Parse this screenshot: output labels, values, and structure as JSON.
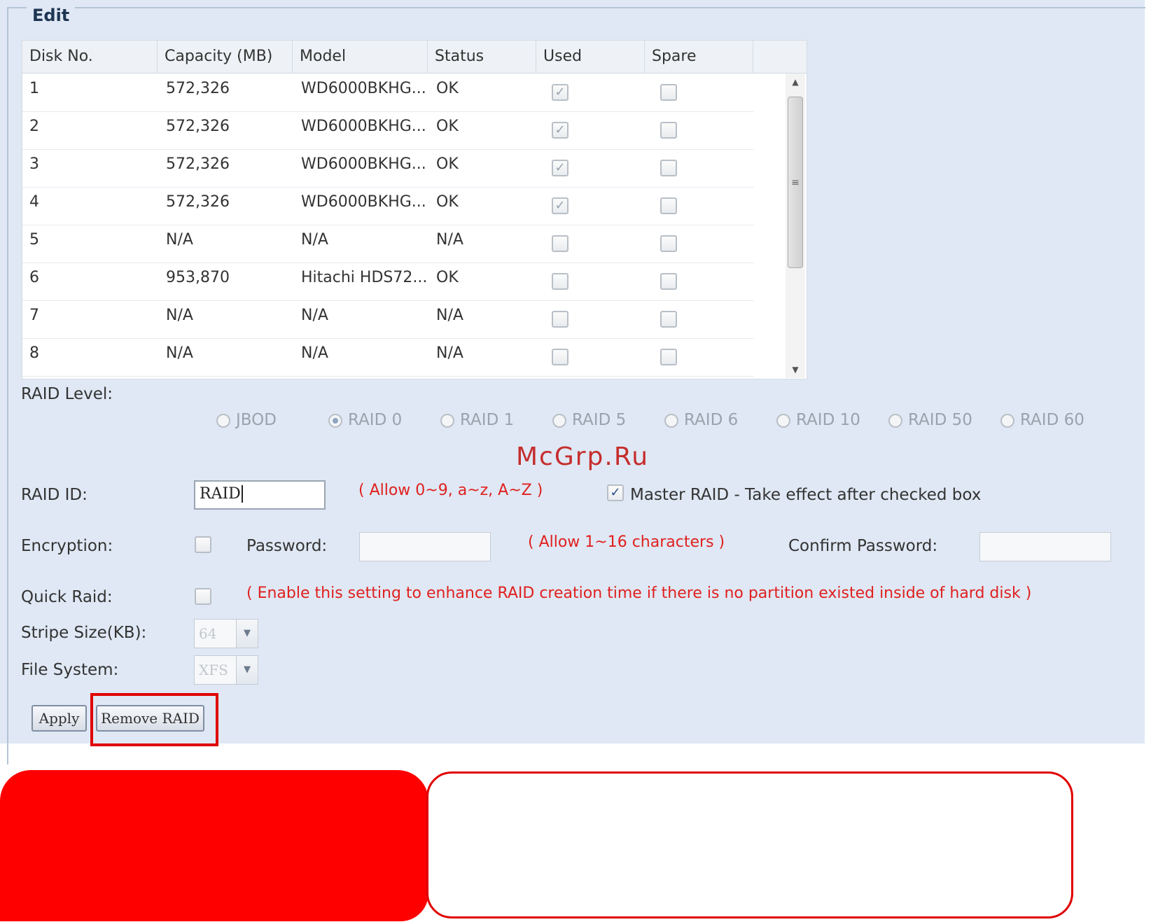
{
  "section_title": "Edit",
  "table": {
    "headers": [
      "Disk No.",
      "Capacity (MB)",
      "Model",
      "Status",
      "Used",
      "Spare"
    ],
    "rows": [
      {
        "disk": "1",
        "capacity": "572,326",
        "model": "WD6000BKHG...",
        "status": "OK",
        "used": true,
        "spare": false
      },
      {
        "disk": "2",
        "capacity": "572,326",
        "model": "WD6000BKHG...",
        "status": "OK",
        "used": true,
        "spare": false
      },
      {
        "disk": "3",
        "capacity": "572,326",
        "model": "WD6000BKHG...",
        "status": "OK",
        "used": true,
        "spare": false
      },
      {
        "disk": "4",
        "capacity": "572,326",
        "model": "WD6000BKHG...",
        "status": "OK",
        "used": true,
        "spare": false
      },
      {
        "disk": "5",
        "capacity": "N/A",
        "model": "N/A",
        "status": "N/A",
        "used": false,
        "spare": false
      },
      {
        "disk": "6",
        "capacity": "953,870",
        "model": "Hitachi HDS72...",
        "status": "OK",
        "used": false,
        "spare": false
      },
      {
        "disk": "7",
        "capacity": "N/A",
        "model": "N/A",
        "status": "N/A",
        "used": false,
        "spare": false
      },
      {
        "disk": "8",
        "capacity": "N/A",
        "model": "N/A",
        "status": "N/A",
        "used": false,
        "spare": false
      }
    ]
  },
  "raid_level": {
    "label": "RAID Level:",
    "options": [
      "JBOD",
      "RAID 0",
      "RAID 1",
      "RAID 5",
      "RAID 6",
      "RAID 10",
      "RAID 50",
      "RAID 60"
    ],
    "selected": "RAID 0"
  },
  "watermark": "McGrp.Ru",
  "raid_id": {
    "label": "RAID ID:",
    "value": "RAID",
    "hint": "( Allow 0~9, a~z, A~Z )",
    "master_checked": true,
    "master_label": "Master RAID - Take effect after checked box"
  },
  "encryption": {
    "label": "Encryption:",
    "password_label": "Password:",
    "hint": "( Allow 1~16 characters )",
    "confirm_label": "Confirm Password:"
  },
  "quick_raid": {
    "label": "Quick Raid:",
    "hint": "( Enable this setting to enhance RAID creation time if there is no partition existed inside of hard disk )"
  },
  "stripe_size": {
    "label": "Stripe Size(KB):",
    "value": "64"
  },
  "file_system": {
    "label": "File System:",
    "value": "XFS"
  },
  "buttons": {
    "apply": "Apply",
    "remove": "Remove RAID"
  },
  "colors": {
    "panel": "#dfe8f4",
    "hint_red": "#e0201f",
    "highlight": "#e00000"
  }
}
